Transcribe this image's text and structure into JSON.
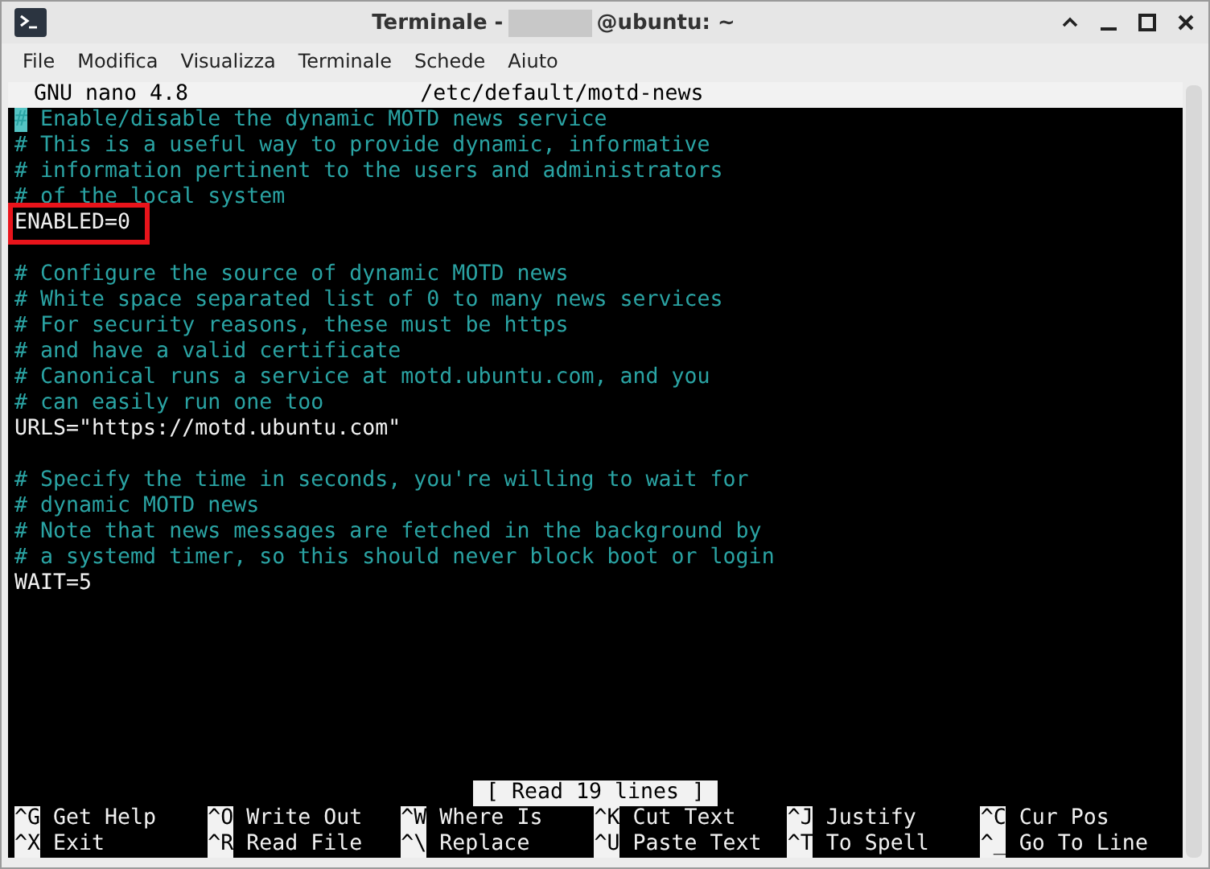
{
  "window": {
    "title_prefix": "Terminale -",
    "title_suffix": "@ubuntu: ~"
  },
  "menu": [
    "File",
    "Modifica",
    "Visualizza",
    "Terminale",
    "Schede",
    "Aiuto"
  ],
  "nano": {
    "version": "GNU nano 4.8",
    "file": "/etc/default/motd-news",
    "lines": [
      {
        "text": "# Enable/disable the dynamic MOTD news service",
        "kind": "comment",
        "cursor": true,
        "highlighted": false
      },
      {
        "text": "# This is a useful way to provide dynamic, informative",
        "kind": "comment",
        "cursor": false,
        "highlighted": false
      },
      {
        "text": "# information pertinent to the users and administrators",
        "kind": "comment",
        "cursor": false,
        "highlighted": false
      },
      {
        "text": "# of the local system",
        "kind": "comment",
        "cursor": false,
        "highlighted": false
      },
      {
        "text": "ENABLED=0",
        "kind": "code",
        "cursor": false,
        "highlighted": true
      },
      {
        "kind": "blank"
      },
      {
        "text": "# Configure the source of dynamic MOTD news",
        "kind": "comment",
        "cursor": false,
        "highlighted": false
      },
      {
        "text": "# White space separated list of 0 to many news services",
        "kind": "comment",
        "cursor": false,
        "highlighted": false
      },
      {
        "text": "# For security reasons, these must be https",
        "kind": "comment",
        "cursor": false,
        "highlighted": false
      },
      {
        "text": "# and have a valid certificate",
        "kind": "comment",
        "cursor": false,
        "highlighted": false
      },
      {
        "text": "# Canonical runs a service at motd.ubuntu.com, and you",
        "kind": "comment",
        "cursor": false,
        "highlighted": false
      },
      {
        "text": "# can easily run one too",
        "kind": "comment",
        "cursor": false,
        "highlighted": false
      },
      {
        "text": "URLS=\"https://motd.ubuntu.com\"",
        "kind": "code",
        "cursor": false,
        "highlighted": false
      },
      {
        "kind": "blank"
      },
      {
        "text": "# Specify the time in seconds, you're willing to wait for",
        "kind": "comment",
        "cursor": false,
        "highlighted": false
      },
      {
        "text": "# dynamic MOTD news",
        "kind": "comment",
        "cursor": false,
        "highlighted": false
      },
      {
        "text": "# Note that news messages are fetched in the background by",
        "kind": "comment",
        "cursor": false,
        "highlighted": false
      },
      {
        "text": "# a systemd timer, so this should never block boot or login",
        "kind": "comment",
        "cursor": false,
        "highlighted": false
      },
      {
        "text": "WAIT=5",
        "kind": "code",
        "cursor": false,
        "highlighted": false
      }
    ],
    "status": "[ Read 19 lines ]",
    "shortcuts": [
      {
        "key": "^G",
        "label": "Get Help"
      },
      {
        "key": "^O",
        "label": "Write Out"
      },
      {
        "key": "^W",
        "label": "Where Is"
      },
      {
        "key": "^K",
        "label": "Cut Text"
      },
      {
        "key": "^J",
        "label": "Justify"
      },
      {
        "key": "^C",
        "label": "Cur Pos"
      },
      {
        "key": "^X",
        "label": "Exit"
      },
      {
        "key": "^R",
        "label": "Read File"
      },
      {
        "key": "^\\",
        "label": "Replace"
      },
      {
        "key": "^U",
        "label": "Paste Text"
      },
      {
        "key": "^T",
        "label": "To Spell"
      },
      {
        "key": "^_",
        "label": "Go To Line"
      }
    ]
  }
}
